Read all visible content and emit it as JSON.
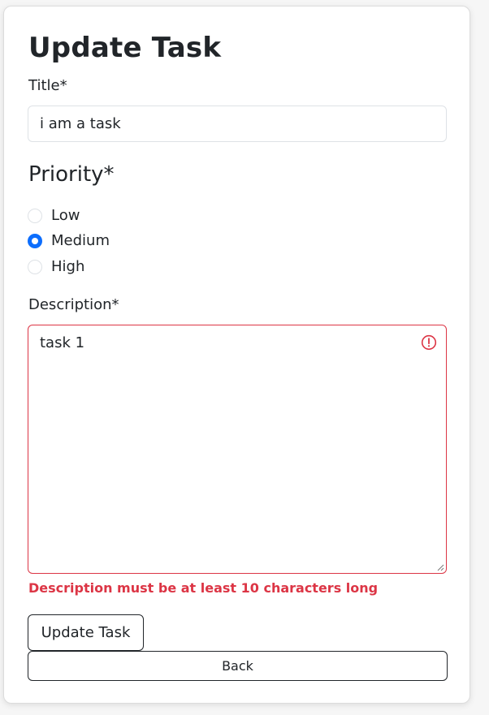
{
  "form": {
    "heading": "Update Task",
    "title_label": "Title*",
    "title_value": "i am a task",
    "priority_heading": "Priority*",
    "priority_options": [
      {
        "label": "Low",
        "checked": false
      },
      {
        "label": "Medium",
        "checked": true
      },
      {
        "label": "High",
        "checked": false
      }
    ],
    "description_label": "Description*",
    "description_value": "task 1",
    "description_error": "Description must be at least 10 characters long",
    "submit_label": "Update Task",
    "back_label": "Back"
  },
  "colors": {
    "error": "#dc3545",
    "accent": "#0d6efd"
  },
  "icons": {
    "description_status": "exclamation-circle-icon"
  }
}
